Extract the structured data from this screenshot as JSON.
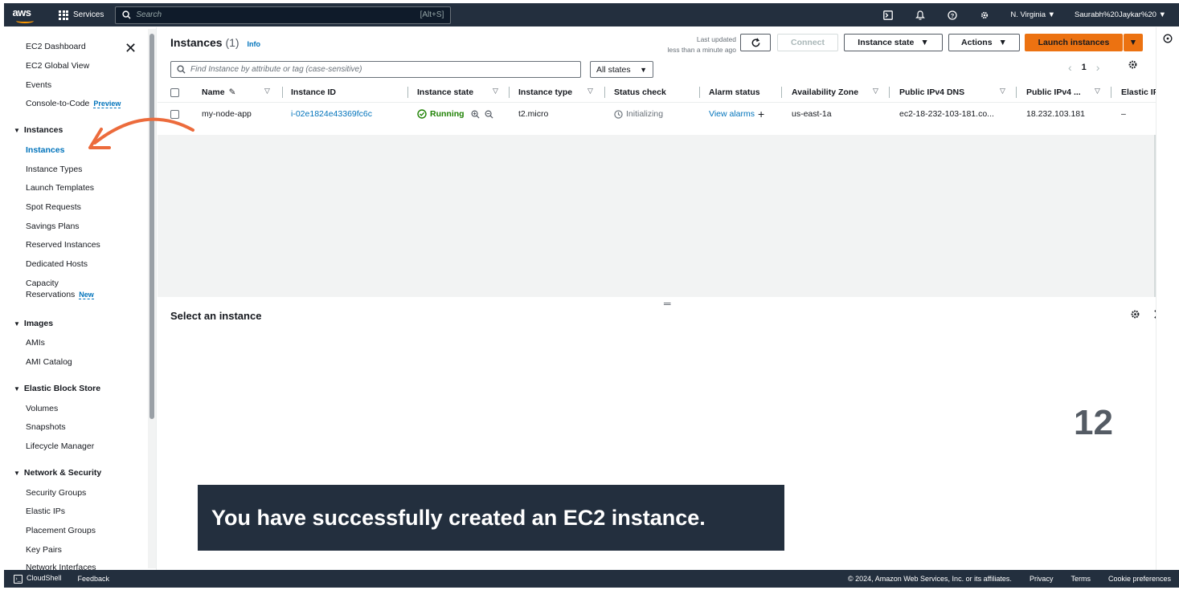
{
  "topnav": {
    "logo": "aws",
    "services": "Services",
    "search_placeholder": "Search",
    "search_shortcut": "[Alt+S]",
    "icons": [
      "cloudshell-icon",
      "bell-icon",
      "help-icon",
      "gear-icon"
    ],
    "region": "N. Virginia ▼",
    "account": "Saurabh%20Jaykar%20 ▼"
  },
  "sidebar": {
    "items": [
      {
        "label": "EC2 Dashboard"
      },
      {
        "label": "EC2 Global View"
      },
      {
        "label": "Events"
      },
      {
        "label": "Console-to-Code",
        "badge": "Preview"
      }
    ],
    "instances_section": {
      "title": "Instances",
      "items": [
        "Instances",
        "Instance Types",
        "Launch Templates",
        "Spot Requests",
        "Savings Plans",
        "Reserved Instances",
        "Dedicated Hosts",
        "Capacity"
      ],
      "capacity_line2": "Reservations",
      "capacity_badge": "New"
    },
    "images_section": {
      "title": "Images",
      "items": [
        "AMIs",
        "AMI Catalog"
      ]
    },
    "ebs_section": {
      "title": "Elastic Block Store",
      "items": [
        "Volumes",
        "Snapshots",
        "Lifecycle Manager"
      ]
    },
    "network_section": {
      "title": "Network & Security",
      "items": [
        "Security Groups",
        "Elastic IPs",
        "Placement Groups",
        "Key Pairs",
        "Network Interfaces"
      ]
    }
  },
  "header": {
    "title": "Instances",
    "count": "(1)",
    "info": "Info",
    "last_updated_1": "Last updated",
    "last_updated_2": "less than a minute ago",
    "connect": "Connect",
    "instance_state": "Instance state",
    "actions": "Actions",
    "launch": "Launch instances"
  },
  "filter": {
    "placeholder": "Find Instance by attribute or tag (case-sensitive)",
    "states": "All states"
  },
  "pager": {
    "page": "1"
  },
  "table": {
    "columns": [
      "Name",
      "Instance ID",
      "Instance state",
      "Instance type",
      "Status check",
      "Alarm status",
      "Availability Zone",
      "Public IPv4 DNS",
      "Public IPv4 ...",
      "Elastic IP"
    ],
    "rows": [
      {
        "name": "my-node-app",
        "instance_id": "i-02e1824e43369fc6c",
        "state": "Running",
        "type": "t2.micro",
        "status_check": "Initializing",
        "alarm": "View alarms",
        "az": "us-east-1a",
        "dns": "ec2-18-232-103-181.co...",
        "ipv4": "18.232.103.181",
        "elastic_ip": "–"
      }
    ]
  },
  "details": {
    "title": "Select an instance"
  },
  "overlay": {
    "caption": "You have successfully created an EC2 instance.",
    "step_number": "12",
    "arrow_color": "#ec6b3c"
  },
  "footer": {
    "cloudshell": "CloudShell",
    "feedback": "Feedback",
    "copyright": "© 2024, Amazon Web Services, Inc. or its affiliates.",
    "privacy": "Privacy",
    "terms": "Terms",
    "cookies": "Cookie preferences"
  }
}
